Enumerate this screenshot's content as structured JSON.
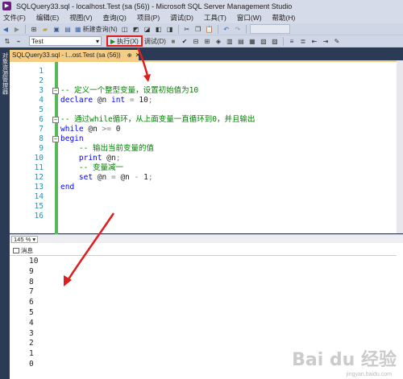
{
  "window": {
    "title": "SQLQuery33.sql - localhost.Test (sa (56)) - Microsoft SQL Server Management Studio"
  },
  "menu": [
    "文件(F)",
    "编辑(E)",
    "视图(V)",
    "查询(Q)",
    "项目(P)",
    "调试(D)",
    "工具(T)",
    "窗口(W)",
    "帮助(H)"
  ],
  "toolbar1": {
    "new_query_label": "新建查询(N)"
  },
  "toolbar2": {
    "database": "Test",
    "execute_label": "执行(X)",
    "debug_label": "调试(D)"
  },
  "left_panel": {
    "label": "对象资源管理器"
  },
  "tab": {
    "label": "SQLQuery33.sql - l...ost.Test (sa (56))",
    "pin": "⊕",
    "close": "✕"
  },
  "editor": {
    "lines": [
      {
        "n": "1",
        "code": ""
      },
      {
        "n": "2",
        "code": ""
      },
      {
        "n": "3",
        "code": "-- 定义一个整型变量，设置初始值为10"
      },
      {
        "n": "4",
        "code": "declare @n int = 10;"
      },
      {
        "n": "5",
        "code": ""
      },
      {
        "n": "6",
        "code": "-- 通过while循环，从上面变量一直循环到0，并且输出"
      },
      {
        "n": "7",
        "code": "while @n >= 0"
      },
      {
        "n": "8",
        "code": "begin"
      },
      {
        "n": "9",
        "code": "    -- 输出当前变量的值"
      },
      {
        "n": "10",
        "code": "    print @n;"
      },
      {
        "n": "11",
        "code": "    -- 变量减一"
      },
      {
        "n": "12",
        "code": "    set @n = @n - 1;"
      },
      {
        "n": "13",
        "code": "end"
      },
      {
        "n": "14",
        "code": ""
      },
      {
        "n": "15",
        "code": ""
      },
      {
        "n": "16",
        "code": ""
      }
    ]
  },
  "zoom": "145 %",
  "results": {
    "tab_label": "消息",
    "output": [
      "10",
      "9",
      "8",
      "7",
      "6",
      "5",
      "4",
      "3",
      "2",
      "1",
      "0"
    ]
  },
  "watermark": {
    "main": "Bai du 经验",
    "sub": "jingyan.baidu.com"
  },
  "colors": {
    "highlight": "#e01e1e",
    "tab_accent": "#f5cc84",
    "comment": "#008000",
    "keyword": "#0000ff"
  }
}
